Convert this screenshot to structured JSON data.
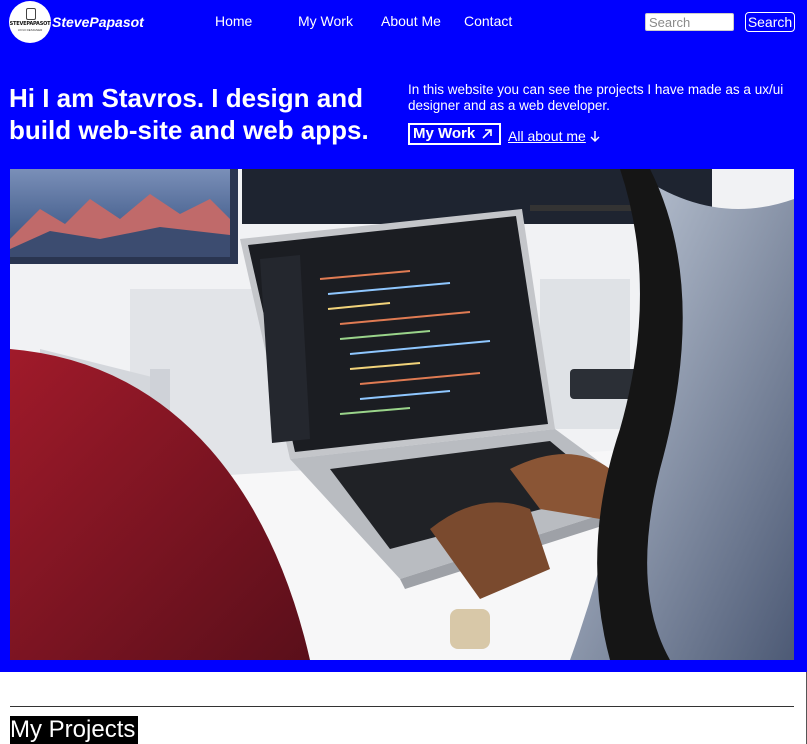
{
  "header": {
    "logo_text": "STEVEPAPASOT",
    "logo_subtext": "UX/UI DESIGNER",
    "brand": "StevePapasot",
    "nav": [
      {
        "label": "Home"
      },
      {
        "label": "My Work"
      },
      {
        "label": "About Me"
      },
      {
        "label": "Contact"
      }
    ],
    "search": {
      "placeholder": "Search",
      "button_label": "Search"
    }
  },
  "hero": {
    "headline": "Hi I am Stavros. I design and build web-site and web apps.",
    "intro": "In this website you can see the projects I have made as a ux/ui designer and as a web developer.",
    "work_button_label": "My Work",
    "work_button_icon": "arrow-up-right-icon",
    "about_link_label": "All about me",
    "about_link_icon": "arrow-down-icon"
  },
  "image": {
    "subject": "photo of a developer typing on a laptop with code on screen"
  },
  "projects": {
    "title": "My Projects"
  },
  "colors": {
    "hero_background": "#0000ff",
    "text_light": "#ffffff",
    "projects_title_background": "#000000"
  }
}
